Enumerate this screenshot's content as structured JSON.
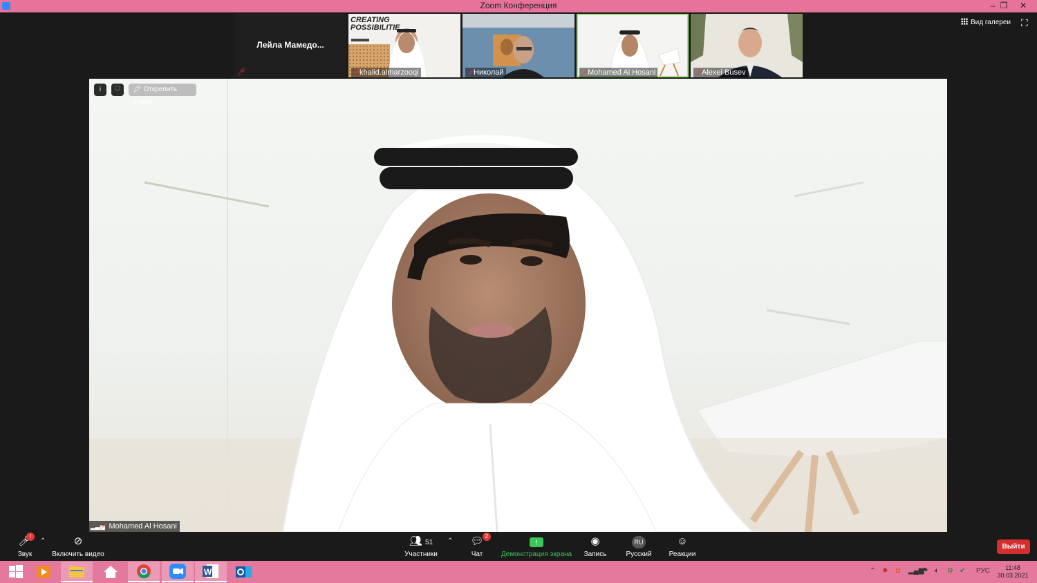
{
  "window": {
    "title": "Zoom Конференция",
    "minimize": "–",
    "restore": "❐",
    "close": "✕"
  },
  "participants_strip": [
    {
      "name": "Лейла  Мамедо...",
      "type": "text"
    },
    {
      "name": "khalid.almarzooqi",
      "type": "video",
      "banner": "CREATING POSSIBILITIE"
    },
    {
      "name": "Николай",
      "type": "video"
    },
    {
      "name": "Mohamed Al Hosani",
      "type": "video",
      "active": true
    },
    {
      "name": "Alexei Busev",
      "type": "video"
    }
  ],
  "view": {
    "gallery_label": "Вид галереи"
  },
  "main_video": {
    "speaker": "Mohamed Al Hosani",
    "unpin_label": "Открепить видео",
    "info_icon": "i"
  },
  "toolbar": {
    "audio": {
      "label": "Звук",
      "icon": "mic-muted-icon"
    },
    "video": {
      "label": "Включить видео",
      "icon": "video-off-icon"
    },
    "participants": {
      "label": "Участники",
      "count": "51"
    },
    "chat": {
      "label": "Чат",
      "badge": "2"
    },
    "share": {
      "label": "Демонстрация экрана",
      "color": "#3ac65a"
    },
    "record": {
      "label": "Запись"
    },
    "language": {
      "label": "Русский",
      "code": "RU"
    },
    "reactions": {
      "label": "Реакции"
    },
    "exit": {
      "label": "Выйти",
      "color": "#d32f2f"
    }
  },
  "taskbar": {
    "lang": "РУС",
    "time": "11:48",
    "date": "30.03.2021",
    "accent": "#e5789d"
  }
}
